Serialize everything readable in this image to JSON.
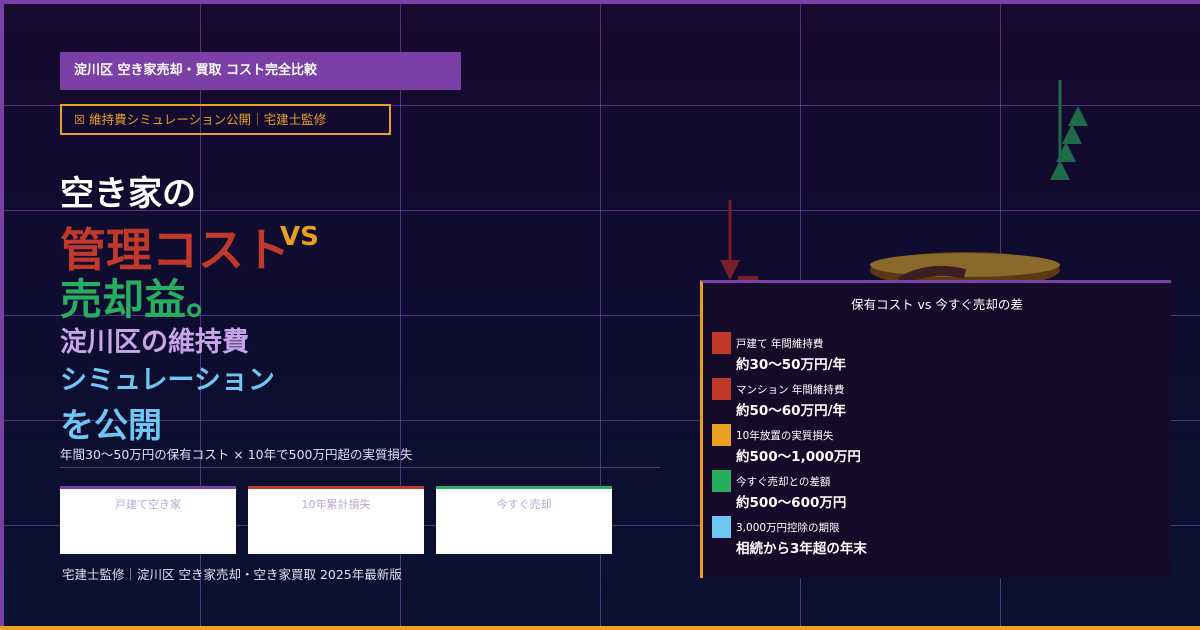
{
  "header": {
    "banner": "淀川区 空き家売却・買取 コスト完全比較",
    "badge": "☒ 維持費シミュレーション公開｜宅建士監修"
  },
  "headline": {
    "line1": "空き家の",
    "line2": "管理コスト",
    "vs": "VS",
    "line3": "売却益。",
    "line4": "淀川区の維持費",
    "line5": "シミュレーション",
    "line6": "を公開"
  },
  "subline": "年間30〜50万円の保有コスト × 10年で500万円超の実質損失",
  "cards": [
    {
      "label": "戸建て空き家"
    },
    {
      "label": "10年累計損失"
    },
    {
      "label": "今すぐ売却"
    }
  ],
  "footer": "宅建士監修｜淀川区 空き家売却・空き家買取 2025年最新版",
  "panel": {
    "title": "保有コスト vs 今すぐ売却の差",
    "rows": [
      {
        "label": "戸建て 年間維持費",
        "value": "約30〜50万円/年",
        "color": "#c0392b"
      },
      {
        "label": "マンション 年間維持費",
        "value": "約50〜60万円/年",
        "color": "#c0392b"
      },
      {
        "label": "10年放置の実質損失",
        "value": "約500〜1,000万円",
        "color": "#e8a020"
      },
      {
        "label": "今すぐ売却との差額",
        "value": "約500〜600万円",
        "color": "#27ae60"
      },
      {
        "label": "3,000万円控除の期限",
        "value": "相続から3年超の年末",
        "color": "#6ec6f5"
      }
    ]
  },
  "colors": {
    "purple": "#7b3fa8",
    "orange": "#e8a020",
    "red": "#c0392b",
    "green": "#27ae60",
    "blue": "#6ec6f5"
  },
  "icons": [
    "tree-icon",
    "down-arrow-icon",
    "coin-stack-icon"
  ]
}
